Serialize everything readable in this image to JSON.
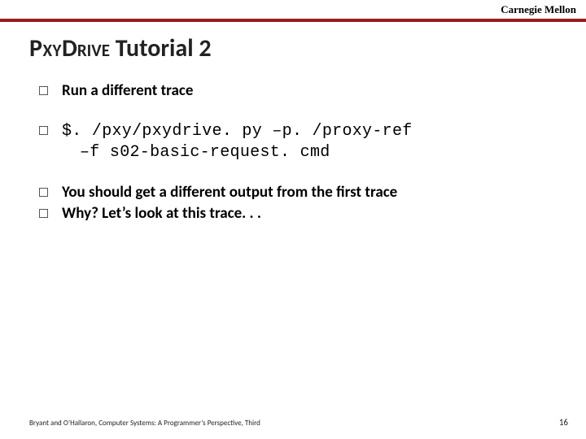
{
  "header": {
    "brand": "Carnegie Mellon"
  },
  "title": {
    "prefix_sc": "Pxy",
    "mid_sc": "Drive",
    "rest": " Tutorial 2"
  },
  "bullets": {
    "b1": "Run a different trace",
    "b2_line1": "$. /pxy/pxydrive. py –p. /proxy-ref",
    "b2_line2": "–f s02-basic-request. cmd",
    "b3": "You should get a different output from the first trace",
    "b4": "Why? Let’s look at this trace. . ."
  },
  "footer": {
    "citation": "Bryant and O’Hallaron, Computer Systems: A Programmer’s Perspective, Third",
    "page": "16"
  }
}
